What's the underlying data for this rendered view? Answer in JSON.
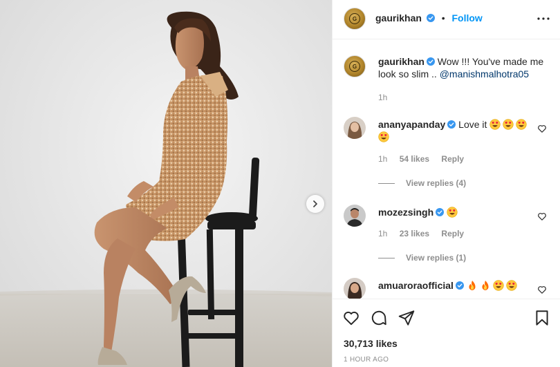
{
  "post": {
    "author": "gaurikhan",
    "follow_label": "Follow",
    "separator": "•",
    "caption_text": "Wow !!! You've made me look so slim .. ",
    "caption_mention": "@manishmalhotra05",
    "caption_time": "1h",
    "likes": "30,713 likes",
    "posted": "1 HOUR AGO"
  },
  "comments": [
    {
      "user": "ananyapanday",
      "text": "Love it",
      "emojis": [
        "heart-eyes",
        "heart-eyes",
        "heart-eyes",
        "heart-eyes"
      ],
      "time": "1h",
      "likes": "54 likes",
      "reply": "Reply",
      "view_replies": "View replies (4)"
    },
    {
      "user": "mozezsingh",
      "text": "",
      "emojis": [
        "heart-eyes"
      ],
      "time": "1h",
      "likes": "23 likes",
      "reply": "Reply",
      "view_replies": "View replies (1)"
    },
    {
      "user": "amuaroraofficial",
      "text": "",
      "emojis": [
        "fire",
        "fire",
        "heart-eyes",
        "heart-eyes"
      ]
    }
  ],
  "icons": {
    "verified": "verified-badge-icon",
    "more": "more-options-icon",
    "next": "chevron-right-icon",
    "like": "heart-icon",
    "comment": "comment-icon",
    "share": "share-icon",
    "save": "bookmark-icon"
  },
  "colors": {
    "follow": "#0095f6",
    "verified": "#3897f0",
    "muted": "#8e8e8e"
  }
}
